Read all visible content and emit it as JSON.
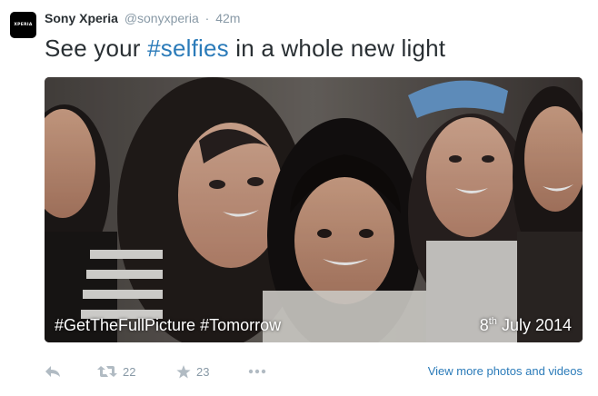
{
  "avatar": {
    "text": "XPERIA",
    "background": "#000000"
  },
  "tweet": {
    "fullname": "Sony Xperia",
    "screen_name": "@sonyxperia",
    "separator": "·",
    "timestamp": "42m",
    "text_before": "See your ",
    "hashtag": "#selfies",
    "text_after": " in a whole new light"
  },
  "media": {
    "caption_left": "#GetTheFullPicture #Tomorrow",
    "caption_date_day": "8",
    "caption_date_suffix": "th",
    "caption_date_rest": " July 2014"
  },
  "actions": {
    "reply_icon": "reply-icon",
    "retweet_icon": "retweet-icon",
    "retweet_count": "22",
    "favorite_icon": "star-icon",
    "favorite_count": "23",
    "more_icon": "ellipsis-icon",
    "view_more": "View more photos and videos"
  },
  "colors": {
    "text": "#292f33",
    "muted": "#8899a6",
    "link": "#2b7bb9"
  }
}
